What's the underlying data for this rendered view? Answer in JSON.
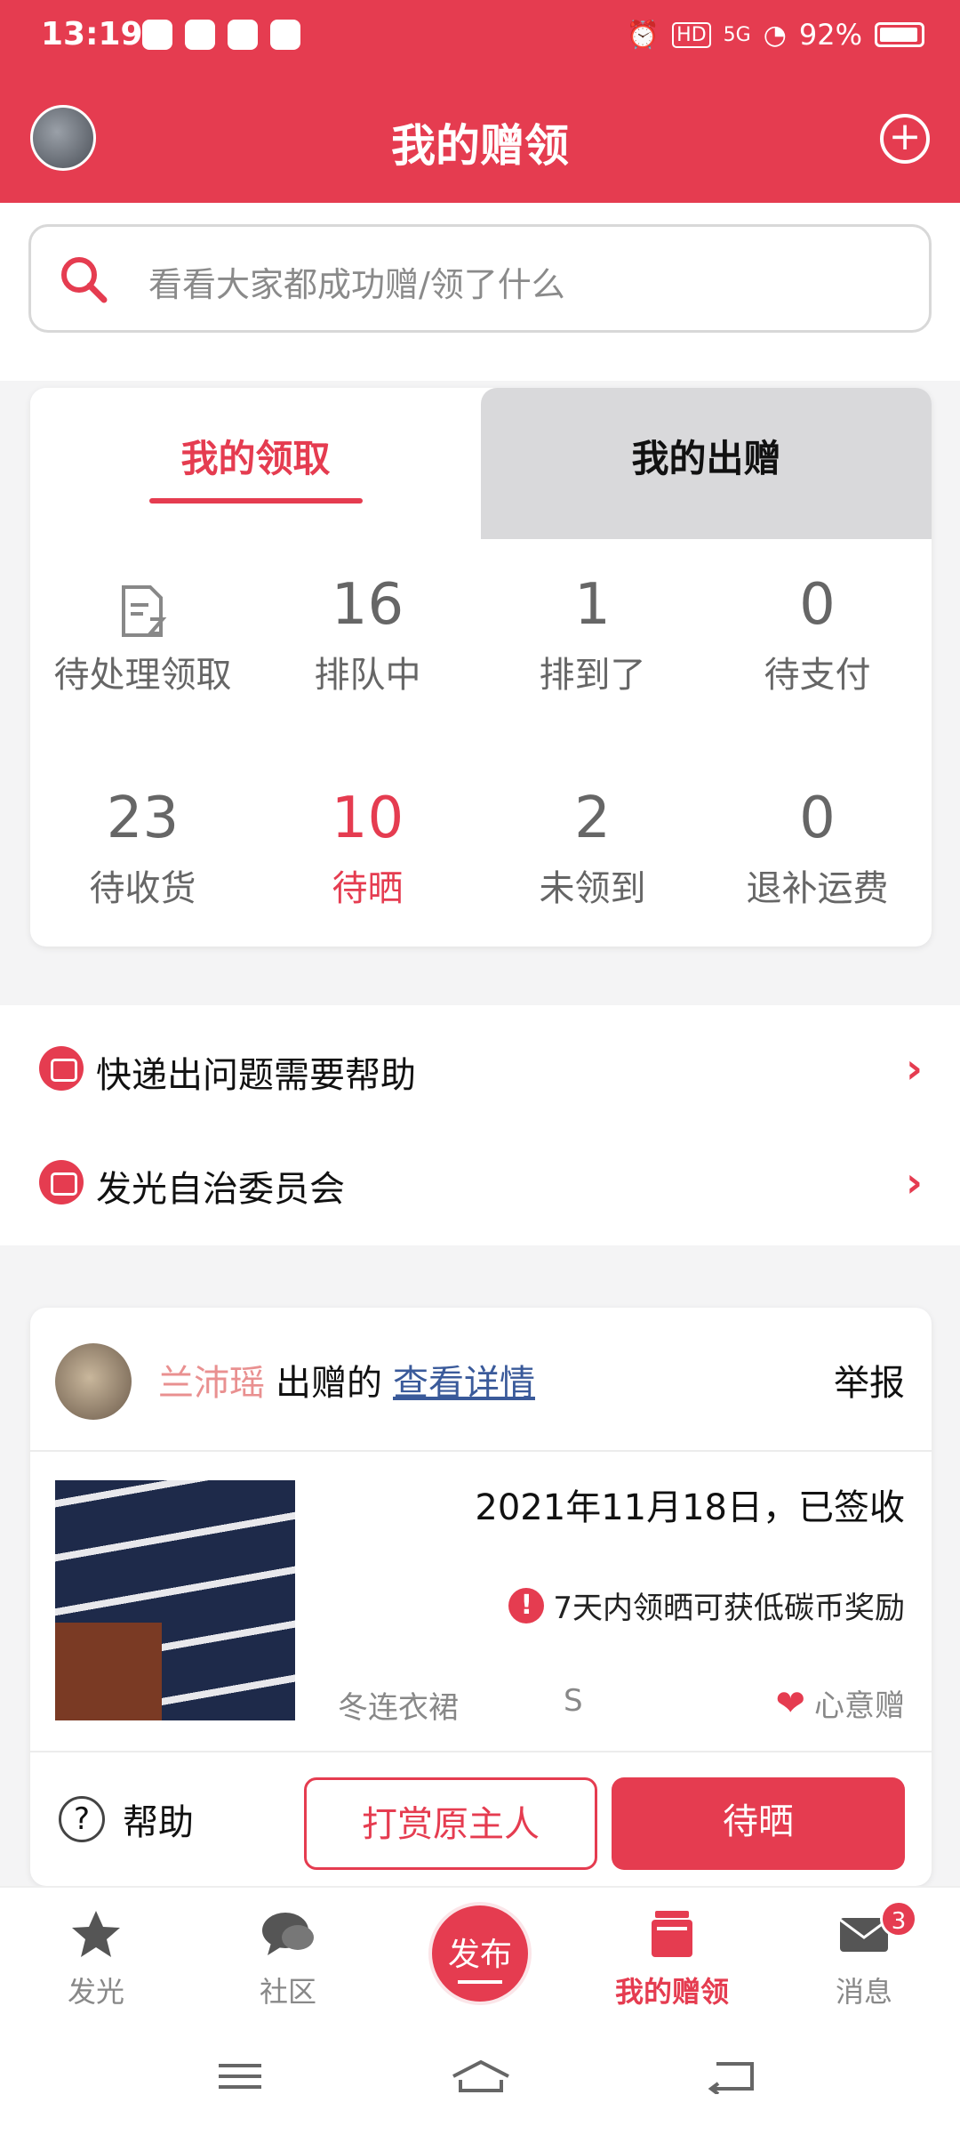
{
  "status": {
    "time": "13:19",
    "battery": "92%",
    "signal": "5G",
    "hd": "HD"
  },
  "header": {
    "title": "我的赠领"
  },
  "search": {
    "placeholder": "看看大家都成功赠/领了什么"
  },
  "tabs": {
    "active": "我的领取",
    "other": "我的出赠"
  },
  "stats": [
    {
      "num": "",
      "label": "待处理领取",
      "icon": "pending-doc-icon"
    },
    {
      "num": "16",
      "label": "排队中"
    },
    {
      "num": "1",
      "label": "排到了"
    },
    {
      "num": "0",
      "label": "待支付"
    },
    {
      "num": "23",
      "label": "待收货"
    },
    {
      "num": "10",
      "label": "待晒",
      "highlight": true
    },
    {
      "num": "2",
      "label": "未领到"
    },
    {
      "num": "0",
      "label": "退补运费"
    }
  ],
  "help_list": [
    {
      "label": "快递出问题需要帮助"
    },
    {
      "label": "发光自治委员会"
    }
  ],
  "order": {
    "giver": "兰沛瑶",
    "action": "出赠的",
    "detail_link": "查看详情",
    "report": "举报",
    "date_status": "2021年11月18日，已签收",
    "tip": "7天内领晒可获低碳币奖励",
    "category": "冬连衣裙",
    "size": "S",
    "gift_type": "心意赠",
    "help": "帮助",
    "tip_button": "打赏原主人",
    "primary_button": "待晒"
  },
  "nav": {
    "items": [
      {
        "label": "发光"
      },
      {
        "label": "社区"
      },
      {
        "label": "发布"
      },
      {
        "label": "我的赠领"
      },
      {
        "label": "消息",
        "badge": "3"
      }
    ]
  },
  "colors": {
    "brand": "#e53c50",
    "bg": "#f4f4f5"
  }
}
